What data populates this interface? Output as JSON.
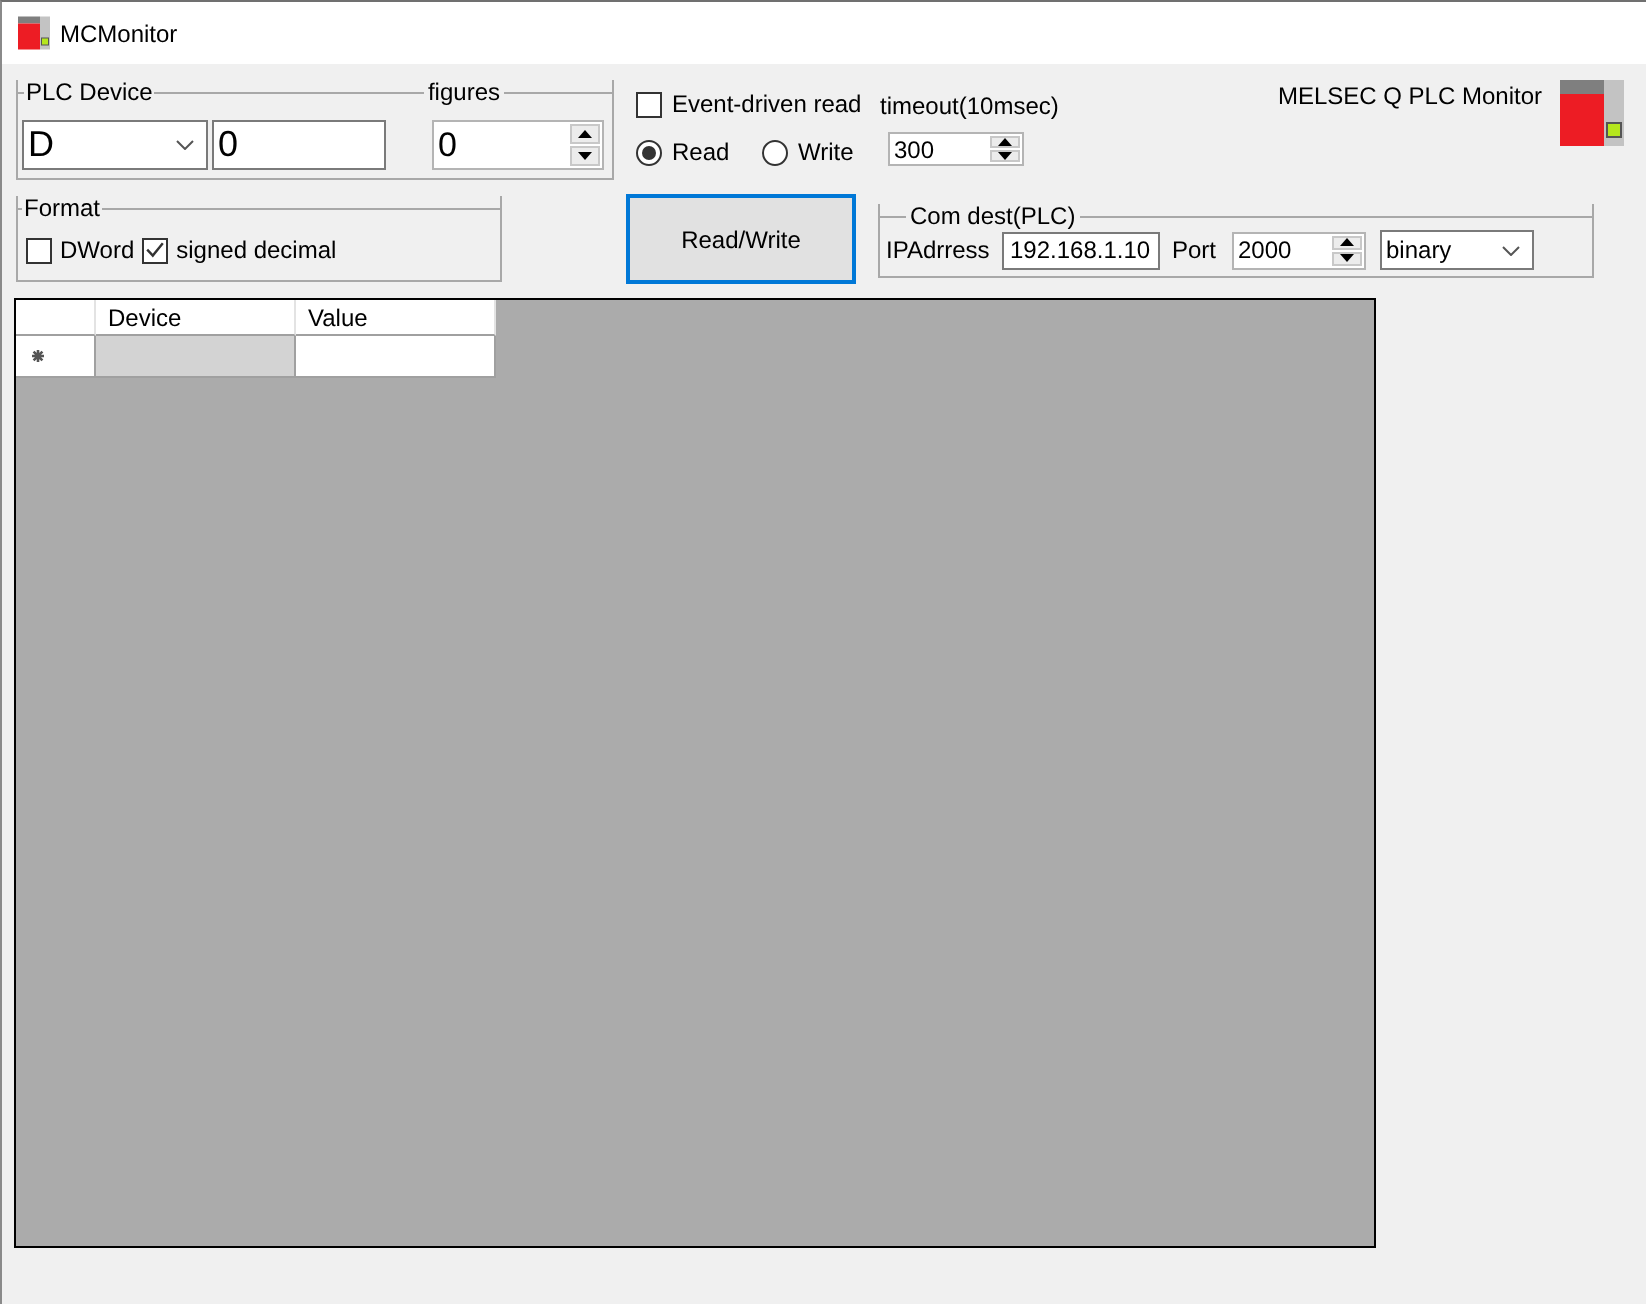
{
  "window": {
    "title": "MCMonitor"
  },
  "plc_device": {
    "label": "PLC Device",
    "device": "D",
    "address": "0",
    "figures_label": "figures",
    "figures": "0"
  },
  "format": {
    "label": "Format",
    "options": [
      {
        "label": "DWord",
        "checked": false
      },
      {
        "label": "signed decimal",
        "checked": true
      }
    ]
  },
  "event_driven_read": {
    "label": "Event-driven read",
    "checked": false
  },
  "mode": [
    {
      "label": "Read",
      "selected": true
    },
    {
      "label": "Write",
      "selected": false
    }
  ],
  "timeout": {
    "label": "timeout(10msec)",
    "value": "300"
  },
  "app_title": "MELSEC Q PLC Monitor",
  "read_write_button": {
    "label": "Read/Write",
    "focused": true
  },
  "com_dest": {
    "label": "Com dest(PLC)",
    "ip_label": "IPAdrress",
    "ip": "192.168.1.10",
    "port_label": "Port",
    "port": "2000",
    "protocol": "binary"
  },
  "grid": {
    "columns": [
      "Device",
      "Value"
    ],
    "rows": [
      {
        "kind": "new",
        "cells": [
          {
            "selected": true
          },
          {
            "selected": false
          }
        ]
      }
    ]
  }
}
